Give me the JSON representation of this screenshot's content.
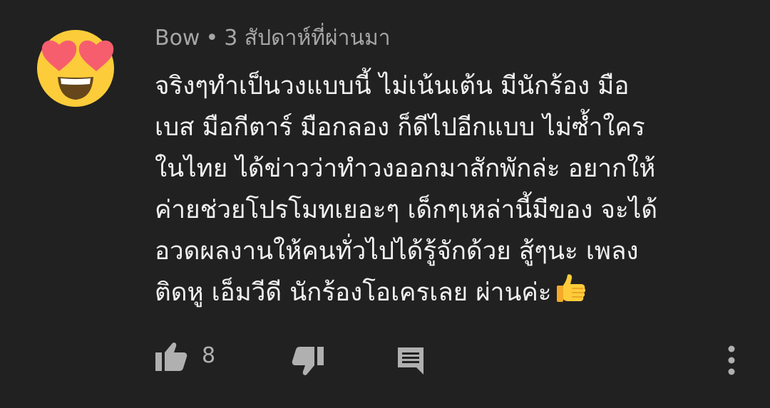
{
  "comment": {
    "author": "Bow",
    "separator": "•",
    "time": "3 สัปดาห์ที่ผ่านมา",
    "lines": [
      "จริงๆทำเป็นวงแบบนี้ ไม่เน้นเต้น มีนักร้อง มือ",
      "เบส มือกีตาร์ มือกลอง ก็ดีไปอีกแบบ ไม่ซ้ำใคร",
      "ในไทย ได้ข่าวว่าทำวงออกมาสักพักล่ะ อยากให้",
      "ค่ายช่วยโปรโมทเยอะๆ เด็กๆเหล่านี้มีของ จะได้",
      "อวดผลงานให้คนทั่วไปได้รู้จักด้วย สู้ๆนะ เพลง",
      "ติดหู เอ็มวีดี นักร้องโอเครเลย ผ่านค่ะ"
    ],
    "avatar_icon": "heart-eyes-emoji-icon",
    "inline_emoji": "thumbs-up-emoji-icon"
  },
  "actions": {
    "like_icon": "thumb-up-icon",
    "like_count": "8",
    "dislike_icon": "thumb-down-icon",
    "reply_icon": "comment-reply-icon",
    "more_icon": "more-vert-icon"
  },
  "colors": {
    "background": "#212121",
    "text": "#f1f1f1",
    "meta": "#a6a6a6",
    "icon": "#b0b0b0",
    "emoji_yellow": "#fccc3a",
    "emoji_heart": "#f65e6e"
  }
}
